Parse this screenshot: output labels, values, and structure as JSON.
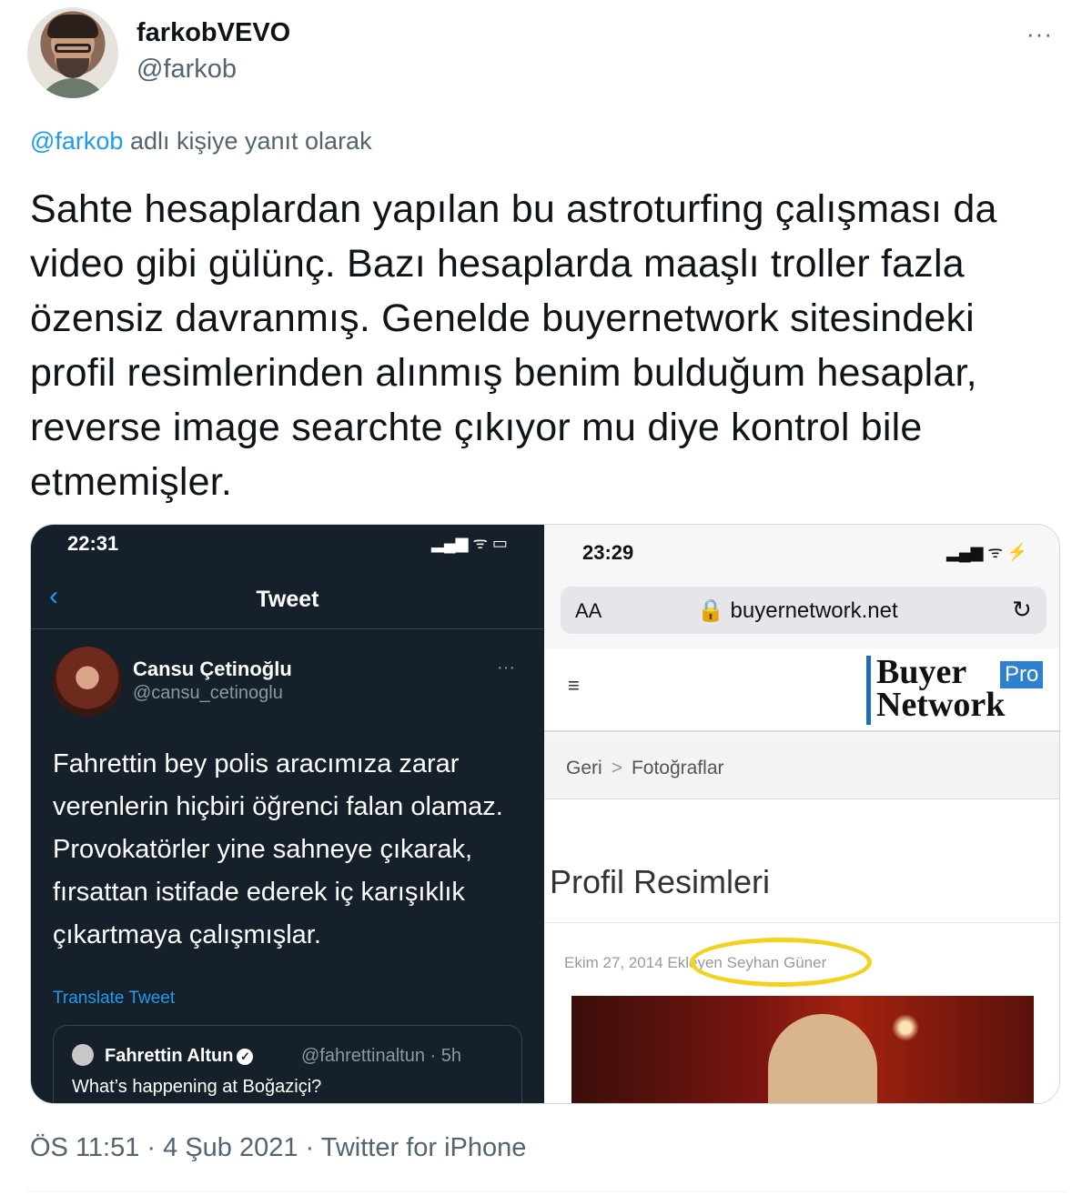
{
  "header": {
    "display_name": "farkobVEVO",
    "handle": "@farkob",
    "more_glyph": "···"
  },
  "reply": {
    "mention": "@farkob",
    "suffix": " adlı kişiye yanıt olarak"
  },
  "tweet": {
    "text": "Sahte hesaplardan yapılan bu astroturfing çalışması da video gibi gülünç. Bazı hesaplarda maaşlı troller fazla özensiz davranmış. Genelde buyernetwork sitesindeki profil resimlerinden alınmış benim bulduğum hesaplar, reverse image searchte çıkıyor mu diye kontrol bile etmemişler."
  },
  "media": {
    "left": {
      "time": "22:31",
      "status_glyphs": "▂▄▆ ᯤ ▭",
      "back_glyph": "‹",
      "title": "Tweet",
      "author_name": "Cansu Çetinoğlu",
      "author_handle": "@cansu_cetinoglu",
      "more_glyph": "···",
      "body": "Fahrettin bey polis aracımıza zarar verenlerin hiçbiri öğrenci falan olamaz. Provokatörler yine sahneye çıkarak, fırsattan istifade ederek iç karışıklık çıkartmaya çalışmışlar.",
      "translate": "Translate Tweet",
      "quote": {
        "name": "Fahrettin Altun",
        "verified_glyph": "✓",
        "handle_time": "@fahrettinaltun · 5h",
        "text": "What’s happening at Boğaziçi?"
      }
    },
    "right": {
      "time": "23:29",
      "status_glyphs": "▂▄▆ ᯤ ⚡",
      "aa": "AA",
      "url": "🔒 buyernetwork.net",
      "reload_glyph": "↻",
      "menu_glyph": "≡",
      "logo_line1": "Buyer",
      "logo_line2": "Network",
      "logo_pro": "Pro",
      "crumb_back": "Geri",
      "crumb_sep": ">",
      "crumb_current": "Fotoğraflar",
      "section_title": "Profil Resimleri",
      "meta": "Ekim 27, 2014 Ekleyen Seyhan Güner",
      "highlight_color": "#f2d21b"
    }
  },
  "footer": {
    "meta": "ÖS 11:51 · 4 Şub 2021 · Twitter for iPhone"
  },
  "colors": {
    "accent": "#1d9bf0",
    "secondary_text": "#536471",
    "dark_bg": "#15202b"
  }
}
